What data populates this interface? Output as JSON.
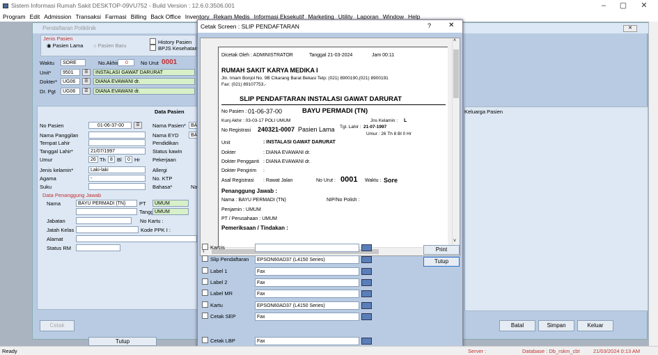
{
  "window": {
    "title": "Sistem Informasi Rumah Sakit DESKTOP-09VU752 - Build Version : 12.6.0.3506.001"
  },
  "menu": [
    "Program",
    "Edit",
    "Admission",
    "Transaksi",
    "Farmasi",
    "Billing",
    "Back Office",
    "Inventory",
    "Rekam Medis",
    "Informasi Eksekutif",
    "Marketing",
    "Utility",
    "Laporan",
    "Window",
    "Help"
  ],
  "status": {
    "left": "Ready",
    "server": "Server :",
    "database": "Database : Db_rskm_cbt",
    "datetime": "21/03/2024  0:13 AM"
  },
  "bg": {
    "title": "Pendaftaran Poliklinik",
    "jenis_pasien": "Jenis Pasien",
    "pasien_lama": "Pasien Lama",
    "pasien_baru": "Pasien Baru",
    "history": "History Pasien",
    "bpjs": "BPJS Kesehatan",
    "waktu_lbl": "Waktu",
    "waktu": "SORE",
    "noakhir_lbl": "No.Akhir",
    "noakhir": "0",
    "nourut_lbl": "No Urut",
    "nourut": "0001",
    "unit_lbl": "Unit*",
    "unit_code": "9501",
    "unit_name": "INSTALASI GAWAT DARURAT",
    "dokter_lbl": "Dokter*",
    "dokter_code": "UG06",
    "dokter_name": "DIANA EVAWANI dr.",
    "drpgt_lbl": "Dr. Pgt",
    "drpgt_code": "UG06",
    "drpgt_name": "DIANA EVAWANI dr.",
    "data_pasien": "Data Pasien",
    "keluarga": "Keluarga Pasien",
    "no_pasien_lbl": "No Pasien",
    "no_pasien": "01-06-37-00",
    "nama_panggilan": "Nama Panggilan",
    "tempat_lahir": "Tempat Lahir",
    "tgl_lahir_lbl": "Tanggal Lahir*",
    "tgl_lahir": "21/07/1997",
    "umur_lbl": "Umur",
    "umur_th": "26",
    "th": "Th",
    "umur_bl": "8",
    "bl": "Bl",
    "umur_hr": "0",
    "hr": "Hr",
    "jk_lbl": "Jenis kelamin*",
    "jk": "Laki-laki",
    "agama_lbl": "Agama",
    "agama": "-",
    "suku_lbl": "Suku",
    "nama_pasien_lbl": "Nama Pasien*",
    "nama_pasien": "BAY",
    "nama_eyd_lbl": "Nama EYD",
    "nama_eyd": "BAY",
    "pendidikan": "Pendidikan",
    "status_kawin": "Status kawin",
    "pekerjaan": "Pekerjaan",
    "alergi": "Allergi",
    "no_ktp": "No. KTP",
    "bahasa": "Bahasa*",
    "bahasa_val": "Nas",
    "pj_title": "Data Penanggung Jawab",
    "nama_lbl": "Nama",
    "nama_pj": "BAYU PERMADI (TN)",
    "pt_lbl": "PT",
    "pt": "UMUM",
    "tangg_lbl": "Tangg",
    "tangg": "UMUM",
    "jabatan": "Jabatan",
    "no_kartu": "No Kartu :",
    "jatah_kelas": "Jatah Kelas",
    "kode_ppk": "Kode PPK I :",
    "alamat": "Alamat",
    "status_rm": "Status RM",
    "cetak": "Cetak",
    "tutup": "Tutup",
    "batal": "Batal",
    "simpan": "Simpan",
    "keluar": "Keluar"
  },
  "dialog": {
    "title": "Cetak Screen : SLIP PENDAFTARAN",
    "help": "?",
    "close": "✕",
    "print": "Print",
    "tutup": "Tutup",
    "slip": {
      "dicetak_oleh": "Dicetak Oleh :  ADMINISTRATOR",
      "tanggal": "Tanggal  21-03-2024",
      "jam": "Jam  00:11",
      "hospital": "RUMAH SAKIT KARYA MEDIKA I",
      "address": "Jln. Imam Bonjol No. 9B Cikarang Barat Bekasi Telp: (021) 8900190,(021) 8900191",
      "fax": "Fax: (021) 89107753,-",
      "heading": "SLIP PENDAFTARAN INSTALASI GAWAT DARURAT",
      "no_pasien_lbl": "No Pasien :",
      "no_pasien": "01-06-37-00",
      "nama": "BAYU PERMADI (TN)",
      "kunj_akhir": "Kunj Akhir :  03-03-17   POLI UMUM",
      "jns_kelamin": "Jns Kelamin :",
      "jk": "L",
      "no_reg_lbl": "No Registrasi",
      "no_reg": "240321-0007",
      "pasien_lama": "Pasien Lama",
      "tgl_lahir_lbl": "Tgl. Lahir :",
      "tgl_lahir": "21-07-1997",
      "umur": "Umur :  26  Th   8   Bl   0   Hr",
      "unit_lbl": "Unit",
      "unit": ":  INSTALASI GAWAT DARURAT",
      "dokter_lbl": "Dokter",
      "dokter": ":  DIANA EVAWANI dr.",
      "pengganti_lbl": "Dokter Pengganti",
      "pengganti": ":  DIANA EVAWANI dr.",
      "pengirim_lbl": "Dokter Pengirim",
      "pengirim": ":",
      "asal_lbl": "Asal Registrasi",
      "asal": ":  Rawat Jalan",
      "nourut_lbl": "No Urut :",
      "nourut": "0001",
      "waktu_lbl": "Waktu :",
      "waktu": "Sore",
      "pj": "Penanggung Jawab :",
      "nama_pj": "Nama :     BAYU PERMADI (TN)",
      "nip": "NIP/No Polish :",
      "penjamin": "Penjamin          :  UMUM",
      "perusahaan": "PT / Perusahaan  :  UMUM",
      "pemeriksaan": "Pemeriksaan / Tindakan :"
    },
    "options": [
      {
        "label": "Karcis",
        "value": ""
      },
      {
        "label": "Slip Pendaftaran",
        "value": "EPSON60AD37 (L4150 Series)"
      },
      {
        "label": "Label 1",
        "value": "Fax"
      },
      {
        "label": "Label 2",
        "value": "Fax"
      },
      {
        "label": "Label MR",
        "value": "Fax"
      },
      {
        "label": "Kartu",
        "value": "EPSON60AD37 (L4150 Series)"
      },
      {
        "label": "Cetak SEP",
        "value": "Fax"
      },
      {
        "label": "Cetak LBP",
        "value": "Fax"
      }
    ]
  }
}
